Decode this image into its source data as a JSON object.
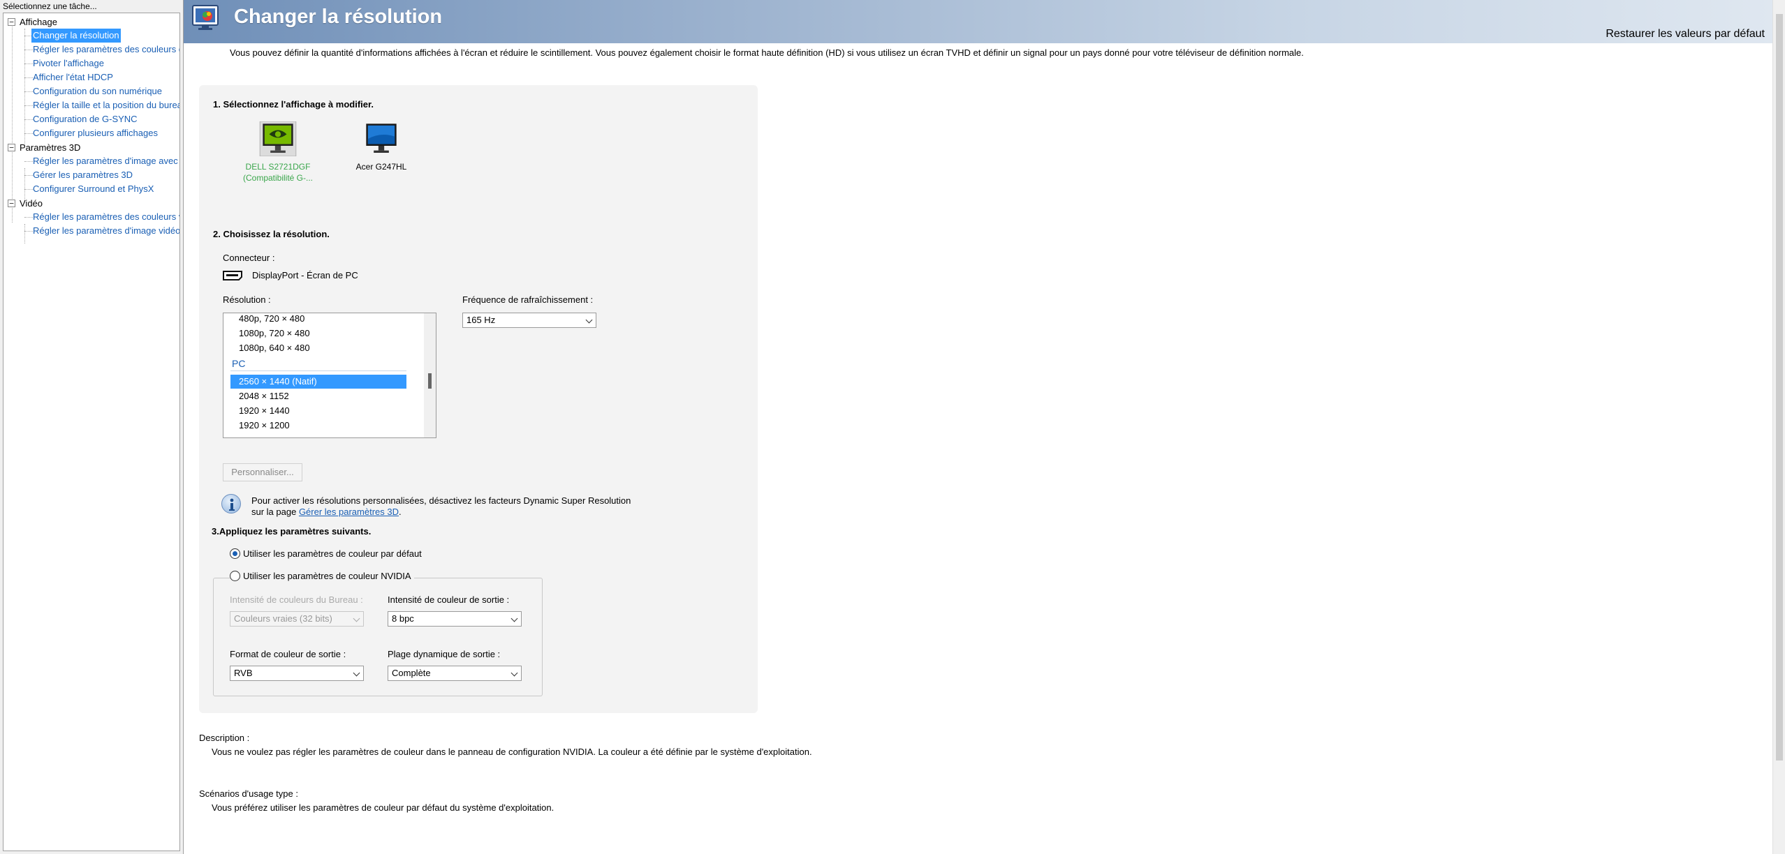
{
  "sidebar": {
    "header": "Sélectionnez une tâche...",
    "categories": [
      {
        "label": "Affichage",
        "items": [
          "Changer la résolution",
          "Régler les paramètres des couleurs d",
          "Pivoter l'affichage",
          "Afficher l'état HDCP",
          "Configuration du son numérique",
          "Régler la taille et la position du burea",
          "Configuration de G-SYNC",
          "Configurer plusieurs affichages"
        ]
      },
      {
        "label": "Paramètres 3D",
        "items": [
          "Régler les paramètres d'image avec a",
          "Gérer les paramètres 3D",
          "Configurer Surround et PhysX"
        ]
      },
      {
        "label": "Vidéo",
        "items": [
          "Régler les paramètres des couleurs v",
          "Régler les paramètres d'image vidéo"
        ]
      }
    ],
    "toggle_glyph": "−"
  },
  "header": {
    "title": "Changer la résolution",
    "restore": "Restaurer les valeurs par défaut"
  },
  "intro": "Vous pouvez définir la quantité d'informations affichées à l'écran et réduire le scintillement. Vous pouvez également choisir le format haute définition (HD) si vous utilisez un écran TVHD et définir un signal pour un pays donné pour votre téléviseur de définition normale.",
  "step1": {
    "title": "1. Sélectionnez l'affichage à modifier.",
    "displays": [
      {
        "line1": "DELL S2721DGF",
        "line2": "(Compatibilité G-..."
      },
      {
        "line1": "Acer G247HL",
        "line2": ""
      }
    ]
  },
  "step2": {
    "title": "2. Choisissez la résolution.",
    "connector_label": "Connecteur :",
    "connector_value": "DisplayPort - Écran de PC",
    "resolution_label": "Résolution :",
    "resolutions_top": [
      "480p, 720 × 480",
      "1080p, 720 × 480",
      "1080p, 640 × 480"
    ],
    "group": "PC",
    "resolutions_pc": [
      "2560 × 1440 (Natif)",
      "2048 × 1152",
      "1920 × 1440",
      "1920 × 1200"
    ],
    "refresh_label": "Fréquence de rafraîchissement :",
    "refresh_value": "165 Hz",
    "customize_button": "Personnaliser...",
    "info_line1": "Pour activer les résolutions personnalisées, désactivez les facteurs Dynamic Super Resolution",
    "info_line2_prefix": "sur la page ",
    "info_link": "Gérer les paramètres 3D",
    "info_line2_suffix": "."
  },
  "step3": {
    "title": "3.Appliquez les paramètres suivants.",
    "radio_default": "Utiliser les paramètres de couleur par défaut",
    "radio_nvidia": "Utiliser les paramètres de couleur NVIDIA",
    "desktop_depth_label": "Intensité de couleurs du Bureau :",
    "desktop_depth_value": "Couleurs vraies (32 bits)",
    "output_depth_label": "Intensité de couleur de sortie :",
    "output_depth_value": "8 bpc",
    "output_format_label": "Format de couleur de sortie :",
    "output_format_value": "RVB",
    "output_range_label": "Plage dynamique de sortie :",
    "output_range_value": "Complète"
  },
  "description": {
    "title": "Description :",
    "body": "Vous ne voulez pas régler les paramètres de couleur dans le panneau de configuration NVIDIA. La couleur a été définie par le système d'exploitation."
  },
  "scenarios": {
    "title": "Scénarios d'usage type :",
    "body": "Vous préférez utiliser les paramètres de couleur par défaut du système d'exploitation."
  },
  "colors": {
    "link": "#1a5fb4",
    "selection": "#3399ff",
    "nvidia_green": "#3aa64b"
  }
}
